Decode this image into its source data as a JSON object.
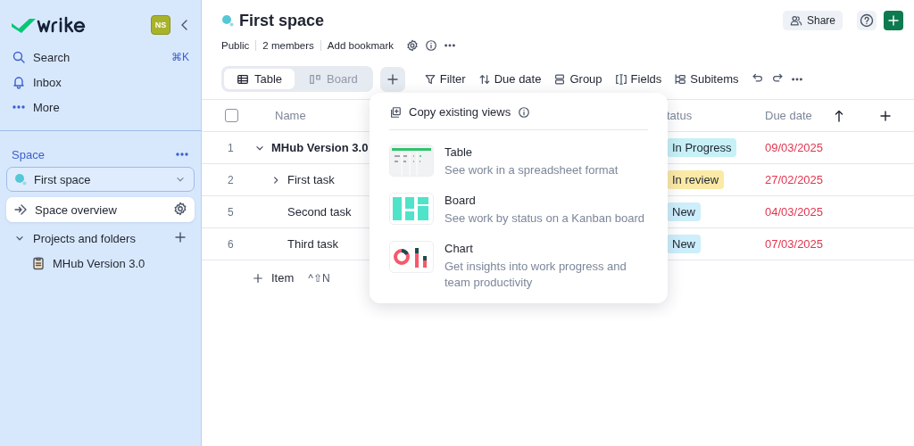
{
  "sidebar": {
    "avatar": "NS",
    "nav": [
      {
        "label": "Search",
        "shortcut": "⌘K"
      },
      {
        "label": "Inbox"
      },
      {
        "label": "More"
      }
    ],
    "space_heading": "Space",
    "space_selector": "First space",
    "items": [
      {
        "label": "Space overview",
        "selected": true
      },
      {
        "label": "Projects and folders",
        "selected": false,
        "expanded": true,
        "children": [
          {
            "label": "MHub Version 3.0",
            "selected": false
          }
        ]
      }
    ]
  },
  "header": {
    "title": "First space",
    "meta": [
      "Public",
      "2 members",
      "Add bookmark"
    ],
    "share": "Share"
  },
  "views": [
    {
      "label": "Table",
      "selected": true
    },
    {
      "label": "Board",
      "selected": false
    }
  ],
  "toolbar": [
    "Filter",
    "Due date",
    "Group",
    "Fields",
    "Subitems"
  ],
  "table": {
    "select_all": {
      "checked": false
    },
    "columns": [
      "Name",
      "tatus",
      "Due date"
    ],
    "rows": [
      {
        "number": "1",
        "name": "MHub Version 3.0",
        "kind": "project",
        "expanded": true,
        "status": "In Progress",
        "color": "#c6f1f6",
        "due": "09/03/2025",
        "children": [
          {
            "number": "2",
            "name": "First task",
            "kind": "task",
            "expanded": false,
            "status": "In review",
            "color": "#fbeaa6",
            "due": "27/02/2025"
          },
          {
            "number": "5",
            "name": "Second task",
            "kind": "task",
            "status": "New",
            "color": "#cdeefb",
            "due": "04/03/2025"
          },
          {
            "number": "6",
            "name": "Third task",
            "kind": "task",
            "status": "New",
            "color": "#cdeefb",
            "due": "07/03/2025"
          }
        ]
      }
    ],
    "add_item": "Item",
    "add_shortcut": "^⇧N"
  },
  "popup": {
    "title": "Copy existing views",
    "options": [
      {
        "kind": "table",
        "title": "Table",
        "description": "See work in a spreadsheet format"
      },
      {
        "kind": "board",
        "title": "Board",
        "description": "See work by status on a Kanban board"
      },
      {
        "kind": "chart",
        "title": "Chart",
        "description": "Get insights into work progress and team productivity"
      }
    ]
  }
}
